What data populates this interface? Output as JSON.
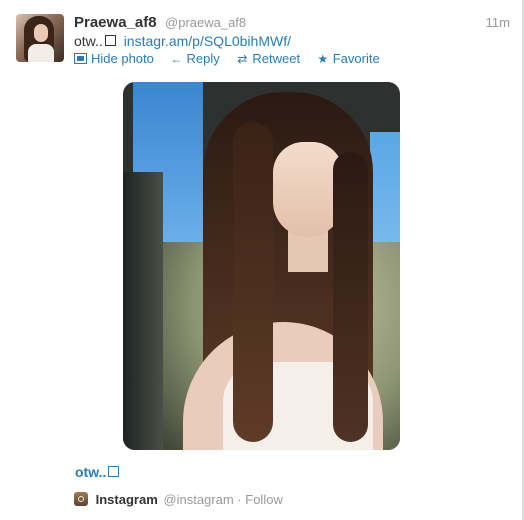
{
  "tweet": {
    "fullname": "Praewa_af8",
    "username": "@praewa_af8",
    "time": "11m",
    "text_prefix": "otw..",
    "link": "instagr.am/p/SQL0bihMWf/",
    "actions": {
      "hide_photo": "Hide photo",
      "reply": "Reply",
      "retweet": "Retweet",
      "favorite": "Favorite"
    },
    "icons": {
      "reply": "reply-arrow-icon",
      "retweet": "retweet-icon",
      "favorite": "star-icon",
      "photo": "photo-icon"
    },
    "caption": "otw..",
    "source": {
      "name": "Instagram",
      "handle": "@instagram",
      "separator": "·",
      "follow": "Follow"
    }
  },
  "colors": {
    "link": "#2b7bb9",
    "muted": "#999999",
    "text": "#333333"
  }
}
